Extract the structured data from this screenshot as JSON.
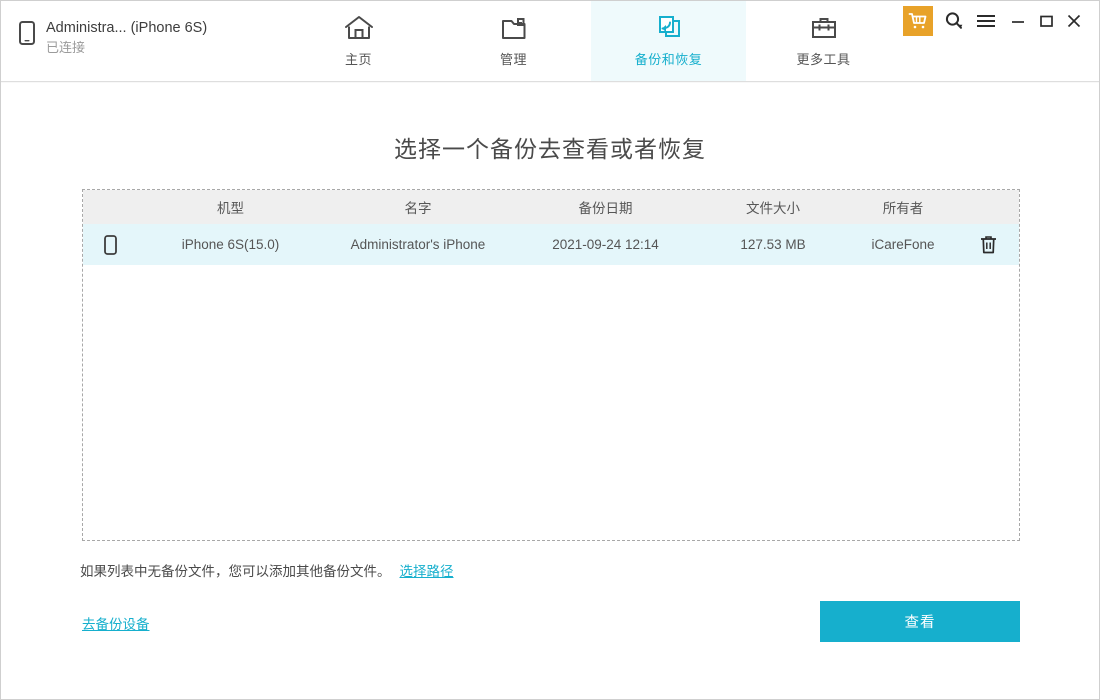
{
  "header": {
    "device": {
      "icon": "phone-icon",
      "name": "Administra... (iPhone 6S)",
      "status": "已连接"
    },
    "tabs": [
      {
        "label": "主页",
        "icon": "home-icon",
        "active": false
      },
      {
        "label": "管理",
        "icon": "folder-icon",
        "active": false
      },
      {
        "label": "备份和恢复",
        "icon": "backup-restore-icon",
        "active": true
      },
      {
        "label": "更多工具",
        "icon": "toolbox-icon",
        "active": false
      }
    ],
    "actions": {
      "cart": "cart-icon",
      "search": "search-icon",
      "menu": "hamburger-menu-icon",
      "minimize": "minimize-icon",
      "maximize": "maximize-icon",
      "close": "close-icon"
    }
  },
  "main": {
    "title": "选择一个备份去查看或者恢复",
    "table": {
      "columns": [
        "机型",
        "名字",
        "备份日期",
        "文件大小",
        "所有者"
      ],
      "rows": [
        {
          "model": "iPhone 6S(15.0)",
          "name": "Administrator's iPhone",
          "date": "2021-09-24 12:14",
          "size": "127.53 MB",
          "owner": "iCareFone",
          "selected": true
        }
      ]
    },
    "hint_text": "如果列表中无备份文件，您可以添加其他备份文件。",
    "hint_link": "选择路径",
    "backup_link": "去备份设备",
    "view_button": "查看"
  },
  "colors": {
    "accent": "#16afcd",
    "accent_light": "#effafc",
    "row_selected": "#e4f6fa",
    "header_row": "#efefef",
    "cart": "#e8a229",
    "text": "#4a4a4a",
    "muted": "#9b9b9b"
  }
}
